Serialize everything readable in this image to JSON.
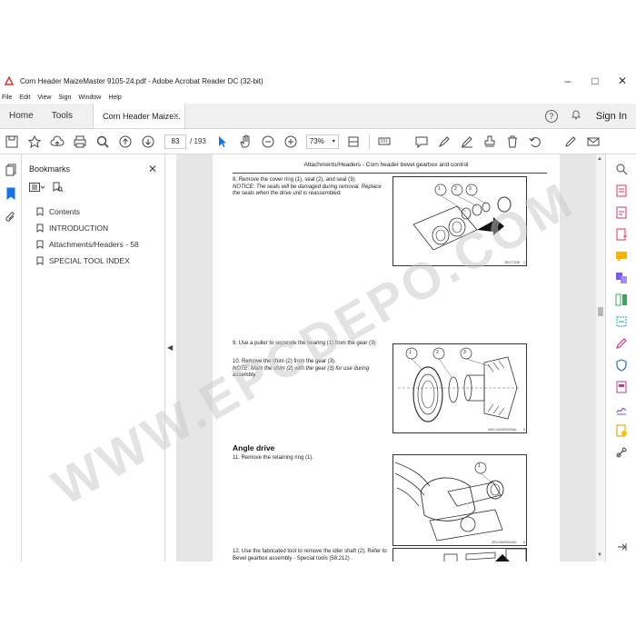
{
  "window": {
    "title": "Corn Header MaizeMaster 9105-24.pdf - Adobe Acrobat Reader DC (32-bit)",
    "controls": {
      "minimize": "–",
      "maximize": "□",
      "close": "✕"
    }
  },
  "menu": [
    "File",
    "Edit",
    "View",
    "Sign",
    "Window",
    "Help"
  ],
  "tabs": {
    "home": "Home",
    "tools": "Tools",
    "document": "Corn Header Maize...",
    "close": "×",
    "help": "?",
    "sign_in": "Sign In"
  },
  "toolbar": {
    "current_page": "83",
    "total_pages": "/ 193",
    "zoom": "73%"
  },
  "bookmarks": {
    "title": "Bookmarks",
    "close": "✕",
    "items": [
      "Contents",
      "INTRODUCTION",
      "Attachments/Headers - 58",
      "SPECIAL TOOL INDEX"
    ]
  },
  "page": {
    "header": "Attachments/Headers - Corn header bevel gearbox and control",
    "steps": [
      {
        "num": "8.",
        "text": "Remove the cover ring (1), seal (2), and seal (3).",
        "note": "NOTICE: The seals will be damaged during removal. Replace the seals when the drive unit is reassembled."
      },
      {
        "num": "9.",
        "text": "Use a puller to separate the bearing (1) from the gear (3).",
        "note": ""
      },
      {
        "num": "10.",
        "text": "Remove the shim (2) from the gear (3).",
        "note": "NOTE: Mark the shim (2) with the gear (3) for use during assembly."
      },
      {
        "num": "11.",
        "text": "Remove the retaining ring (1).",
        "note": ""
      },
      {
        "num": "12.",
        "text": "Use the fabricated tool to remove the idler shaft (2). Refer to Bevel gearbox assembly - Special tools (58.212) .",
        "note": ""
      }
    ],
    "section": "Angle drive",
    "figures": [
      {
        "id": "2BO77038",
        "num": "4"
      },
      {
        "id": "NHIL14GH00002AA",
        "num": "5"
      },
      {
        "id": "ZEIL09WH004AS",
        "num": "6"
      }
    ],
    "callouts": [
      "1",
      "2",
      "3"
    ]
  },
  "watermark": "WWW.EPCDEPO.COM"
}
